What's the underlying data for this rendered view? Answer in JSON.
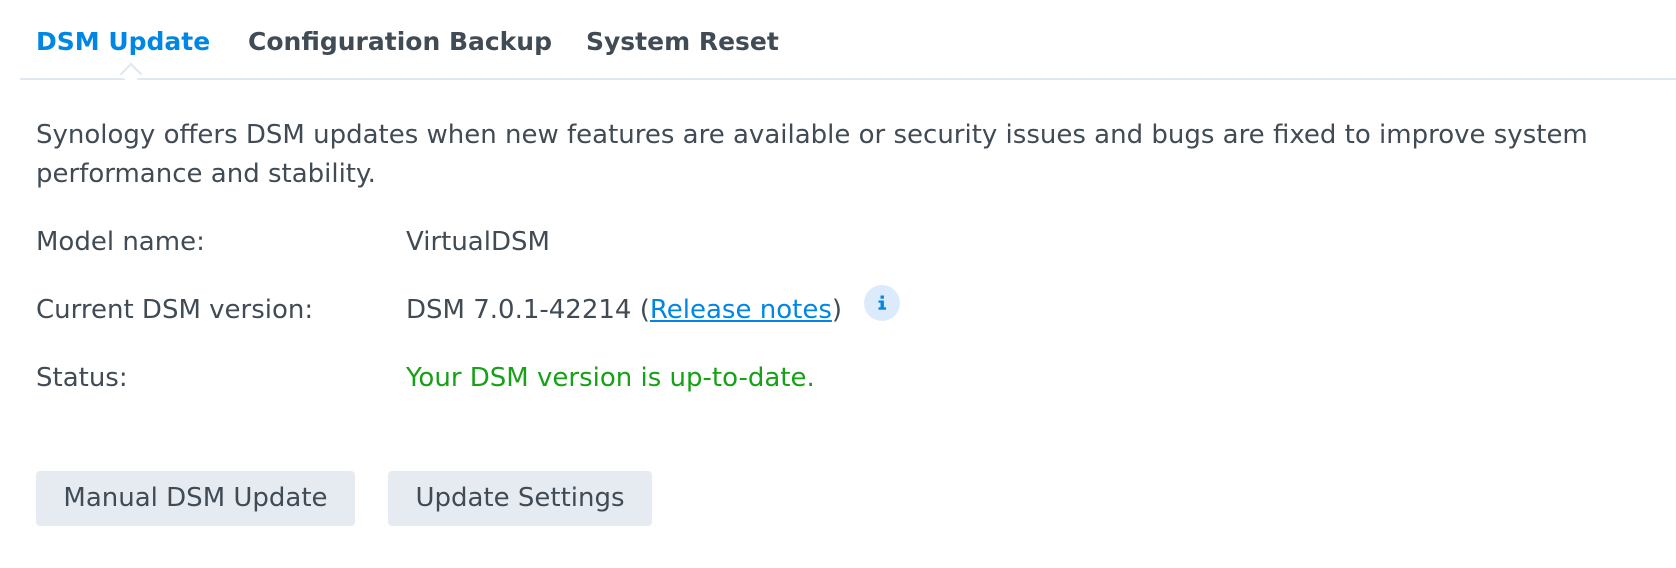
{
  "tabs": [
    {
      "label": "DSM Update",
      "active": true
    },
    {
      "label": "Configuration Backup",
      "active": false
    },
    {
      "label": "System Reset",
      "active": false
    }
  ],
  "description": "Synology offers DSM updates when new features are available or security issues and bugs are fixed to improve system performance and stability.",
  "info": {
    "model_label": "Model name:",
    "model_value": "VirtualDSM",
    "version_label": "Current DSM version:",
    "version_value": "DSM 7.0.1-42214",
    "release_notes_label": "Release notes",
    "status_label": "Status:",
    "status_value": "Your DSM version is up-to-date."
  },
  "icons": {
    "info_icon": "info-icon"
  },
  "buttons": {
    "manual_update": "Manual DSM Update",
    "update_settings": "Update Settings"
  },
  "colors": {
    "accent": "#0086e5",
    "status_ok": "#17a117",
    "text": "#414b55",
    "button_bg": "#e6ebf1",
    "info_icon_bg": "#dcebfb"
  }
}
